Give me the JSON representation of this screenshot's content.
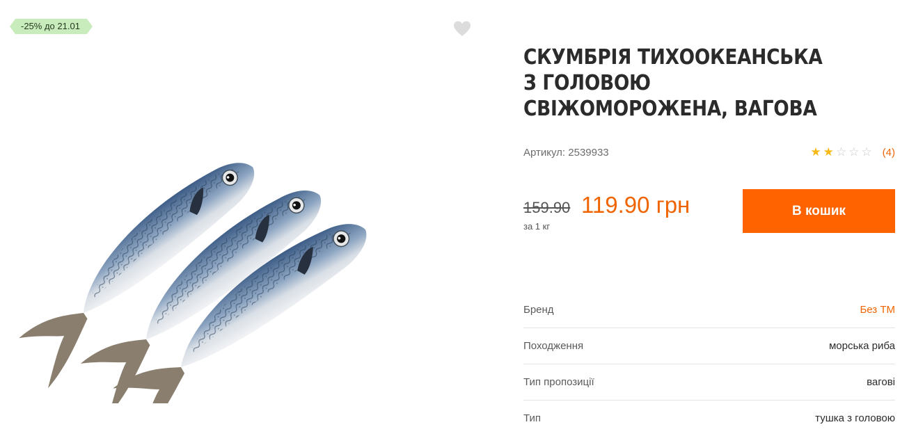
{
  "colors": {
    "accent": "#ff6300",
    "promo_bg": "#c9ecbd",
    "star": "#f6b917"
  },
  "promo": {
    "label": "-25% до 21.01"
  },
  "product": {
    "title": "СКУМБРІЯ ТИХООКЕАНСЬКА З ГОЛОВОЮ СВІЖОМОРОЖЕНА, ВАГОВА",
    "sku_label": "Артикул: 2539933",
    "rating": 2,
    "rating_max": 5,
    "review_count": "(4)",
    "image_icon": "mackerel-fish-photo",
    "favorite_icon": "heart-icon"
  },
  "price": {
    "old": "159.90",
    "current": "119.90 грн",
    "unit": "за 1 кг"
  },
  "actions": {
    "add_to_cart": "В кошик"
  },
  "specs": [
    {
      "label": "Бренд",
      "value": "Без ТМ"
    },
    {
      "label": "Походження",
      "value": "морська риба"
    },
    {
      "label": "Тип пропозиції",
      "value": "вагові"
    },
    {
      "label": "Тип",
      "value": "тушка з головою"
    }
  ]
}
